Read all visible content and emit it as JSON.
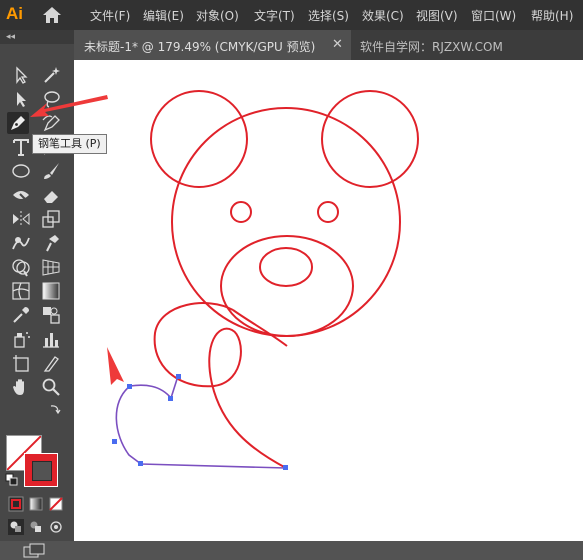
{
  "app": {
    "logo": "Ai"
  },
  "menu": {
    "items": [
      "文件(F)",
      "编辑(E)",
      "对象(O)",
      "文字(T)",
      "选择(S)",
      "效果(C)",
      "视图(V)",
      "窗口(W)",
      "帮助(H)"
    ]
  },
  "tabs": {
    "active_title": "未标题-1* @ 179.49% (CMYK/GPU 预览)",
    "close": "✕",
    "second_title": "软件自学网：RJZXW.COM"
  },
  "toolbar": {
    "collapse": "◂◂",
    "tooltip": "钢笔工具 (P)",
    "active_tool": "pen-tool",
    "tools": [
      "selection-tool",
      "magic-wand-tool",
      "direct-selection-tool",
      "lasso-tool",
      "pen-tool",
      "curvature-tool",
      "type-tool",
      "line-tool",
      "ellipse-tool",
      "paintbrush-tool",
      "shaper-tool",
      "eraser-tool",
      "reflect-tool",
      "scale-tool",
      "warp-tool",
      "free-transform-tool",
      "shape-builder-tool",
      "puppet-warp-tool",
      "mesh-tool",
      "gradient-tool",
      "eyedropper-tool",
      "blend-tool",
      "symbol-sprayer-tool",
      "column-graph-tool",
      "artboard-tool",
      "slice-tool",
      "hand-tool",
      "zoom-tool"
    ]
  },
  "colors": {
    "stroke": "#e0222a",
    "path_selected": "#7b4fc0",
    "anchor": "#4a6cf0",
    "arrow": "#ee3a3a"
  }
}
